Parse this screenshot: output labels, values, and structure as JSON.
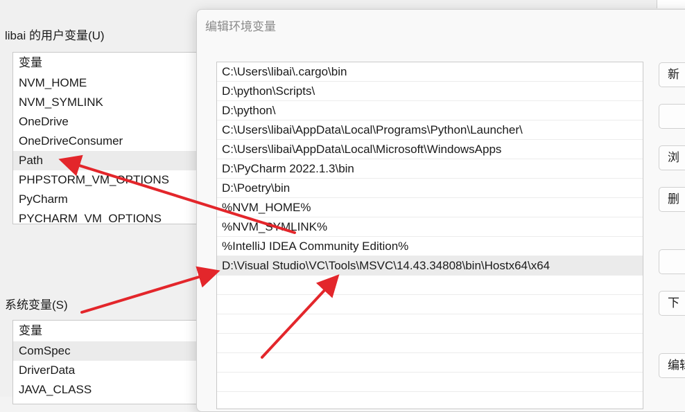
{
  "user_vars": {
    "label": "libai 的用户变量(U)",
    "header": "变量",
    "items": [
      "NVM_HOME",
      "NVM_SYMLINK",
      "OneDrive",
      "OneDriveConsumer",
      "Path",
      "PHPSTORM_VM_OPTIONS",
      "PyCharm",
      "PYCHARM_VM_OPTIONS"
    ],
    "selected": "Path"
  },
  "system_vars": {
    "label": "系统变量(S)",
    "header": "变量",
    "items": [
      "ComSpec",
      "DriverData",
      "JAVA_CLASS"
    ],
    "selected": "ComSpec"
  },
  "dialog": {
    "title": "编辑环境变量",
    "entries": [
      "C:\\Users\\libai\\.cargo\\bin",
      "D:\\python\\Scripts\\",
      "D:\\python\\",
      "C:\\Users\\libai\\AppData\\Local\\Programs\\Python\\Launcher\\",
      "C:\\Users\\libai\\AppData\\Local\\Microsoft\\WindowsApps",
      "D:\\PyCharm 2022.1.3\\bin",
      "D:\\Poetry\\bin",
      "%NVM_HOME%",
      "%NVM_SYMLINK%",
      "%IntelliJ IDEA Community Edition%",
      "D:\\Visual Studio\\VC\\Tools\\MSVC\\14.43.34808\\bin\\Hostx64\\x64"
    ],
    "selected_index": 10,
    "buttons": {
      "new": "新",
      "edit": "",
      "browse": "浏",
      "delete": "删",
      "move_up": "",
      "move_down": "下",
      "edit_text": "编辑"
    }
  },
  "colors": {
    "arrow": "#e3262b",
    "selection": "#ebebeb"
  }
}
